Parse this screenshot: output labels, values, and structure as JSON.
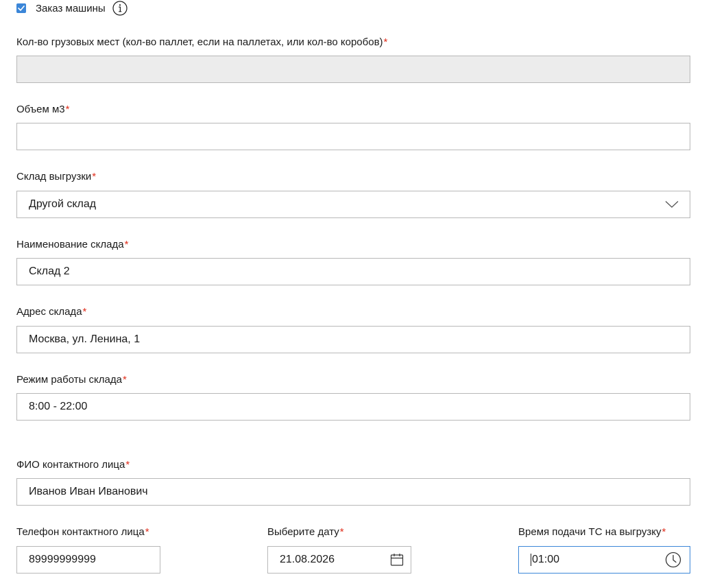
{
  "car_order": {
    "checked": true,
    "label": "Заказ машины"
  },
  "fields": {
    "cargo_places": {
      "label": "Кол-во грузовых мест (кол-во паллет, если на паллетах, или кол-во коробов)",
      "required_mark": "*",
      "value": "",
      "disabled": true
    },
    "volume": {
      "label": "Объем м3",
      "required_mark": "*",
      "value": ""
    },
    "unload_warehouse": {
      "label": "Склад выгрузки",
      "required_mark": "*",
      "value": "Другой склад"
    },
    "warehouse_name": {
      "label": "Наименование склада",
      "required_mark": "*",
      "value": "Склад 2"
    },
    "warehouse_address": {
      "label": "Адрес склада",
      "required_mark": "*",
      "value": "Москва, ул. Ленина, 1"
    },
    "warehouse_hours": {
      "label": "Режим работы склада",
      "required_mark": "*",
      "value": "8:00 - 22:00"
    },
    "contact_name": {
      "label": "ФИО контактного лица",
      "required_mark": "*",
      "value": "Иванов Иван Иванович"
    },
    "contact_phone": {
      "label": "Телефон контактного лица",
      "required_mark": "*",
      "value": "89999999999"
    },
    "date": {
      "label": "Выберите дату",
      "required_mark": "*",
      "value": "21.08.2026"
    },
    "arrival_time": {
      "label": "Время подачи ТС на выгрузку",
      "required_mark": "*",
      "value": "01:00"
    }
  },
  "colors": {
    "accent": "#3b86d8",
    "required": "#e0301e",
    "border": "#b8b8b8",
    "disabled_bg": "#ececec"
  },
  "icons": {
    "checkbox": "checkmark-icon",
    "info": "info-circle-icon",
    "dropdown": "chevron-down-icon",
    "date": "calendar-icon",
    "time": "clock-icon"
  }
}
